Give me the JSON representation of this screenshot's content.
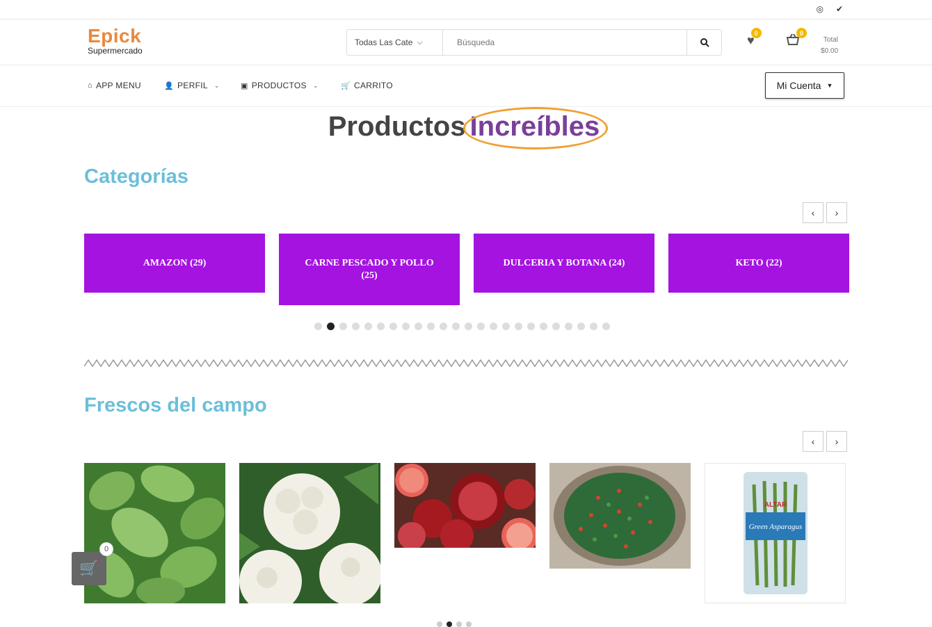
{
  "social": {
    "icons": [
      "instagram-icon",
      "twitter-icon"
    ],
    "instagram_glyph": "◎",
    "twitter_glyph": "✔"
  },
  "header": {
    "brand": "Epick",
    "subtitle": "Supermercado",
    "search": {
      "category": "Todas Las Cate",
      "placeholder": "Búsqueda"
    },
    "wishlist_count": "0",
    "cart_count": "0",
    "total_label": "Total",
    "total_value": "$0.00"
  },
  "nav": {
    "items": [
      {
        "label": "APP MENU",
        "icon": "home-icon"
      },
      {
        "label": "PERFIL",
        "icon": "user-plus-icon"
      },
      {
        "label": "PRODUCTOS",
        "icon": "basket-icon"
      },
      {
        "label": "CARRITO",
        "icon": "cart-icon"
      }
    ],
    "account": "Mi Cuenta"
  },
  "hero": {
    "word1": "Productos",
    "word2": "Increíbles"
  },
  "categories": {
    "title": "Categorías",
    "items": [
      {
        "label": "AMAZON (29)"
      },
      {
        "label": "CARNE PESCADO Y POLLO (25)"
      },
      {
        "label": "DULCERIA Y BOTANA (24)"
      },
      {
        "label": "KETO (22)"
      }
    ],
    "dots": 24,
    "active_dot": 2
  },
  "fresh": {
    "title": "Frescos del campo",
    "products": [
      "herb-leaves-image",
      "cauliflower-image",
      "pomegranate-grapefruit-image",
      "peas-basket-image",
      "green-beans-package-image"
    ],
    "package_brand": "ALTAR",
    "package_text": "Green Asparagus"
  },
  "floating_cart": {
    "count": "0"
  },
  "colors": {
    "brand": "#e8893e",
    "category_bg": "#a413e0",
    "section_title": "#6bbfd9",
    "badge": "#f5b800",
    "hero_accent": "#7a3f9a"
  }
}
